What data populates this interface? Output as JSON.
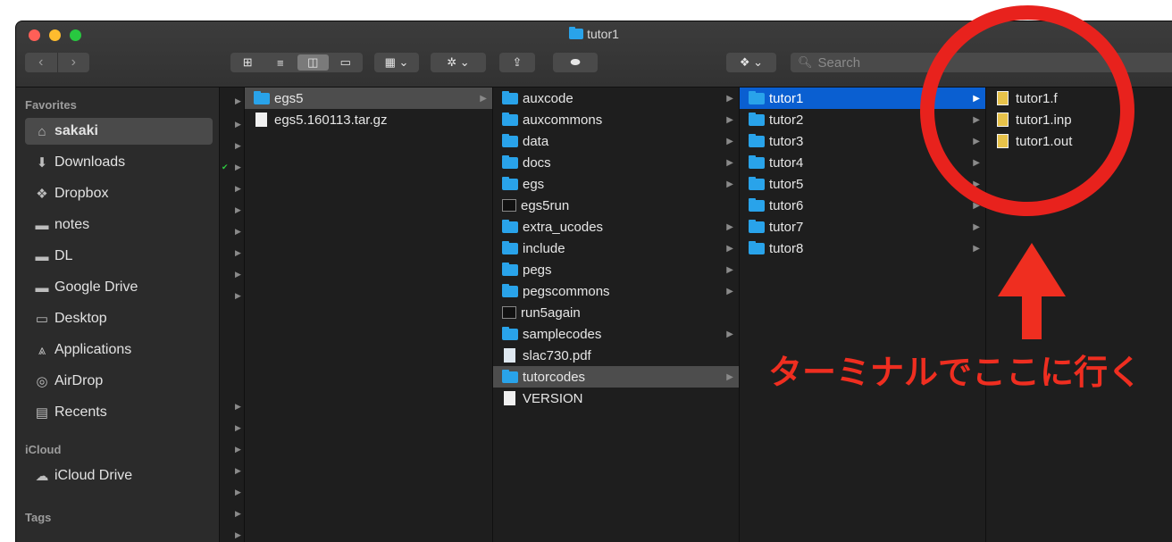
{
  "window": {
    "title": "tutor1"
  },
  "toolbar": {
    "back_glyph": "‹",
    "forward_glyph": "›",
    "search_placeholder": "Search",
    "icons": [
      "icon-view-icon",
      "list-view-icon",
      "column-view-icon",
      "gallery-view-icon",
      "group-icon",
      "gear-icon",
      "share-icon",
      "tag-icon",
      "dropbox-icon",
      "search-icon"
    ]
  },
  "sidebar": {
    "favorites_label": "Favorites",
    "icloud_label": "iCloud",
    "tags_label": "Tags",
    "items": [
      {
        "label": "sakaki",
        "icon": "home-icon"
      },
      {
        "label": "Downloads",
        "icon": "download-icon"
      },
      {
        "label": "Dropbox",
        "icon": "dropbox-icon"
      },
      {
        "label": "notes",
        "icon": "folder-icon"
      },
      {
        "label": "DL",
        "icon": "folder-icon"
      },
      {
        "label": "Google Drive",
        "icon": "folder-icon"
      },
      {
        "label": "Desktop",
        "icon": "desktop-icon"
      },
      {
        "label": "Applications",
        "icon": "applications-icon"
      },
      {
        "label": "AirDrop",
        "icon": "airdrop-icon"
      },
      {
        "label": "Recents",
        "icon": "recents-icon"
      }
    ],
    "icloud_items": [
      {
        "label": "iCloud Drive",
        "icon": "cloud-icon"
      }
    ]
  },
  "columns": {
    "col1": [
      {
        "label": "egs5",
        "kind": "folder",
        "arrow": true
      },
      {
        "label": "egs5.160113.tar.gz",
        "kind": "doc",
        "arrow": false
      }
    ],
    "col2": [
      {
        "label": "auxcode",
        "kind": "folder",
        "arrow": true
      },
      {
        "label": "auxcommons",
        "kind": "folder",
        "arrow": true
      },
      {
        "label": "data",
        "kind": "folder",
        "arrow": true
      },
      {
        "label": "docs",
        "kind": "folder",
        "arrow": true
      },
      {
        "label": "egs",
        "kind": "folder",
        "arrow": true
      },
      {
        "label": "egs5run",
        "kind": "term",
        "arrow": false
      },
      {
        "label": "extra_ucodes",
        "kind": "folder",
        "arrow": true
      },
      {
        "label": "include",
        "kind": "folder",
        "arrow": true
      },
      {
        "label": "pegs",
        "kind": "folder",
        "arrow": true
      },
      {
        "label": "pegscommons",
        "kind": "folder",
        "arrow": true
      },
      {
        "label": "run5again",
        "kind": "term",
        "arrow": false
      },
      {
        "label": "samplecodes",
        "kind": "folder",
        "arrow": true
      },
      {
        "label": "slac730.pdf",
        "kind": "pdf",
        "arrow": false
      },
      {
        "label": "tutorcodes",
        "kind": "folder",
        "arrow": true
      },
      {
        "label": "VERSION",
        "kind": "doc",
        "arrow": false
      }
    ],
    "col3": [
      {
        "label": "tutor1",
        "kind": "folder",
        "arrow": true
      },
      {
        "label": "tutor2",
        "kind": "folder",
        "arrow": true
      },
      {
        "label": "tutor3",
        "kind": "folder",
        "arrow": true
      },
      {
        "label": "tutor4",
        "kind": "folder",
        "arrow": true
      },
      {
        "label": "tutor5",
        "kind": "folder",
        "arrow": true
      },
      {
        "label": "tutor6",
        "kind": "folder",
        "arrow": true
      },
      {
        "label": "tutor7",
        "kind": "folder",
        "arrow": true
      },
      {
        "label": "tutor8",
        "kind": "folder",
        "arrow": true
      }
    ],
    "col4": [
      {
        "label": "tutor1.f",
        "kind": "src"
      },
      {
        "label": "tutor1.inp",
        "kind": "src"
      },
      {
        "label": "tutor1.out",
        "kind": "src"
      }
    ]
  },
  "annotation": {
    "text": "ターミナルでここに行く",
    "color": "#ef2e20"
  }
}
